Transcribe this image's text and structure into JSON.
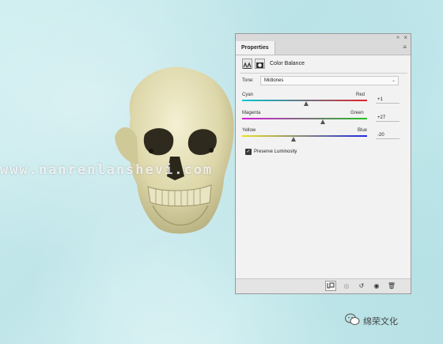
{
  "watermark": "www.nanrenlanshevi.com",
  "panel": {
    "tab_label": "Properties",
    "collapse_glyph": "»",
    "close_glyph": "×",
    "menu_glyph": "≡",
    "adjustment_title": "Color Balance",
    "tone": {
      "label": "Tone:",
      "selected": "Midtones"
    },
    "sliders": [
      {
        "left_label": "Cyan",
        "right_label": "Red",
        "value": "+1",
        "gradient": [
          "#00c8d8",
          "#e0202a"
        ]
      },
      {
        "left_label": "Magenta",
        "right_label": "Green",
        "value": "+27",
        "gradient": [
          "#d81ad8",
          "#22c022"
        ]
      },
      {
        "left_label": "Yellow",
        "right_label": "Blue",
        "value": "-20",
        "gradient": [
          "#e8e020",
          "#2028e0"
        ]
      }
    ],
    "preserve_luminosity": {
      "label": "Preserve Luminosity",
      "checked": true
    }
  },
  "icons": {
    "clip": "clip-to-layer-icon",
    "view_prev": "view-previous-state-icon",
    "reset": "reset-icon",
    "visibility": "visibility-icon",
    "delete": "delete-icon"
  },
  "brand": "绵荣文化"
}
